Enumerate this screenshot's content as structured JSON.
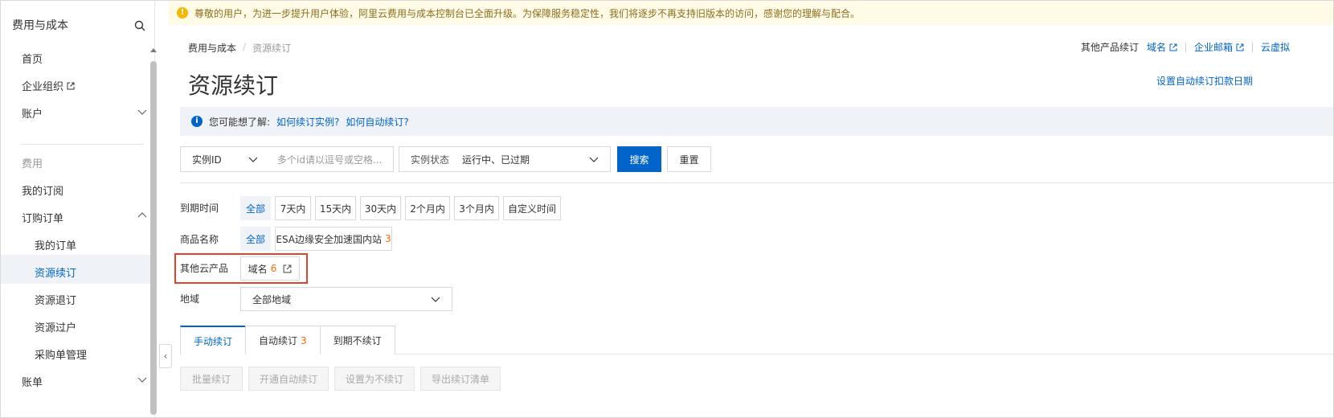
{
  "sidebar": {
    "title": "费用与成本",
    "items": [
      {
        "label": "首页"
      },
      {
        "label": "企业组织"
      },
      {
        "label": "账户"
      },
      {
        "label": "费用"
      },
      {
        "label": "我的订阅"
      },
      {
        "label": "订购订单"
      },
      {
        "label": "我的订单"
      },
      {
        "label": "资源续订"
      },
      {
        "label": "资源退订"
      },
      {
        "label": "资源过户"
      },
      {
        "label": "采购单管理"
      },
      {
        "label": "账单"
      }
    ]
  },
  "notice": "尊敬的用户，为进一步提升用户体验，阿里云费用与成本控制台已全面升级。为保障服务稳定性，我们将逐步不再支持旧版本的访问，感谢您的理解与配合。",
  "breadcrumb": [
    "费用与成本",
    "资源续订"
  ],
  "toplinks": {
    "label": "其他产品续订",
    "links": [
      "域名",
      "企业邮箱",
      "云虚拟"
    ]
  },
  "page_title": "资源续订",
  "set_date_link": "设置自动续订扣款日期",
  "info": {
    "prefix": "您可能想了解:",
    "link1": "如何续订实例?",
    "link2": "如何自动续订?"
  },
  "filters": {
    "id_select": "实例ID",
    "id_placeholder": "多个id请以逗号或空格...",
    "state_label": "实例状态",
    "state_value": "运行中、已过期",
    "search_btn": "搜索",
    "reset_btn": "重置"
  },
  "expiry": {
    "label": "到期时间",
    "options": [
      "全部",
      "7天内",
      "15天内",
      "30天内",
      "2个月内",
      "3个月内",
      "自定义时间"
    ]
  },
  "product": {
    "label": "商品名称",
    "all": "全部",
    "esa_label": "ESA边缘安全加速国内站",
    "esa_count": "3"
  },
  "other": {
    "label": "其他云产品",
    "domain": "域名",
    "domain_count": "6"
  },
  "region": {
    "label": "地域",
    "value": "全部地域"
  },
  "tabs": {
    "manual": "手动续订",
    "auto": "自动续订",
    "auto_count": "3",
    "no_renew": "到期不续订"
  },
  "actions": [
    "批量续订",
    "开通自动续订",
    "设置为不续订",
    "导出续订清单"
  ],
  "colors": {
    "primary": "#0064c8",
    "count": "#ff6a00",
    "highlight": "#e0442a"
  }
}
